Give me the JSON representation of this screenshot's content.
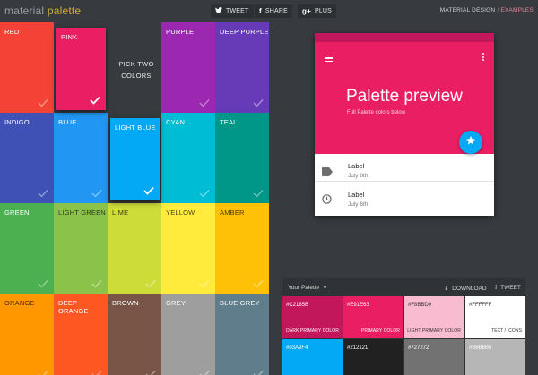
{
  "brand": {
    "part1": "material",
    "part2": "palette"
  },
  "header": {
    "tweet": "TWEET",
    "share": "SHARE",
    "plus": "PLUS",
    "material_design": "MATERIAL DESIGN",
    "separator": "/",
    "examples": "EXAMPLES"
  },
  "grid": {
    "pick_two": "PICK TWO COLORS",
    "colors": [
      {
        "label": "RED",
        "hex": "#F44336",
        "text": "#ffffff"
      },
      {
        "label": "PINK",
        "hex": "#E91E63",
        "text": "#ffffff",
        "selected": true
      },
      {
        "label": "",
        "hex": "#373B3F",
        "text": "#ffffff"
      },
      {
        "label": "PURPLE",
        "hex": "#9C27B0",
        "text": "#ffffff"
      },
      {
        "label": "DEEP PURPLE",
        "hex": "#673AB7",
        "text": "#ffffff"
      },
      {
        "label": "INDIGO",
        "hex": "#3F51B5",
        "text": "#ffffff"
      },
      {
        "label": "BLUE",
        "hex": "#2196F3",
        "text": "#ffffff"
      },
      {
        "label": "LIGHT BLUE",
        "hex": "#03A9F4",
        "text": "#ffffff",
        "selected": true
      },
      {
        "label": "CYAN",
        "hex": "#00BCD4",
        "text": "#ffffff"
      },
      {
        "label": "TEAL",
        "hex": "#009688",
        "text": "#ffffff"
      },
      {
        "label": "GREEN",
        "hex": "#4CAF50",
        "text": "#ffffff"
      },
      {
        "label": "LIGHT GREEN",
        "hex": "#8BC34A",
        "text": "#2f3a22"
      },
      {
        "label": "LIME",
        "hex": "#CDDC39",
        "text": "#3a3f14"
      },
      {
        "label": "YELLOW",
        "hex": "#FFEB3B",
        "text": "#4a4410"
      },
      {
        "label": "AMBER",
        "hex": "#FFC107",
        "text": "#4a3a08"
      },
      {
        "label": "ORANGE",
        "hex": "#FF9800",
        "text": "#4a2e05"
      },
      {
        "label": "DEEP ORANGE",
        "hex": "#FF5722",
        "text": "#ffffff"
      },
      {
        "label": "BROWN",
        "hex": "#795548",
        "text": "#ffffff"
      },
      {
        "label": "GREY",
        "hex": "#9E9E9E",
        "text": "#ffffff"
      },
      {
        "label": "BLUE GREY",
        "hex": "#607D8B",
        "text": "#ffffff"
      }
    ]
  },
  "preview": {
    "title": "Palette preview",
    "subtitle": "Full Palette colors below",
    "primary": "#E91E63",
    "primary_dark": "#C2185B",
    "accent": "#03A9F4",
    "items": [
      {
        "label": "Label",
        "date": "July 8th",
        "icon": "label-icon"
      },
      {
        "label": "Label",
        "date": "July 6th",
        "icon": "clock-icon"
      }
    ]
  },
  "your_palette": {
    "title": "Your Palette",
    "download": "DOWNLOAD",
    "tweet": "TWEET",
    "swatches": [
      {
        "hex": "#C2185B",
        "role": "DARK PRIMARY COLOR",
        "bg": "#C2185B",
        "text": "#ffffff"
      },
      {
        "hex": "#E91E63",
        "role": "PRIMARY COLOR",
        "bg": "#E91E63",
        "text": "#ffffff"
      },
      {
        "hex": "#F8BBD0",
        "role": "LIGHT PRIMARY COLOR",
        "bg": "#F8BBD0",
        "text": "#333333"
      },
      {
        "hex": "#FFFFFF",
        "role": "TEXT / ICONS",
        "bg": "#FFFFFF",
        "text": "#333333"
      },
      {
        "hex": "#03A9F4",
        "role": "",
        "bg": "#03A9F4",
        "text": "#ffffff"
      },
      {
        "hex": "#212121",
        "role": "",
        "bg": "#212121",
        "text": "#ffffff"
      },
      {
        "hex": "#727272",
        "role": "",
        "bg": "#727272",
        "text": "#ffffff"
      },
      {
        "hex": "#B6B6B6",
        "role": "",
        "bg": "#B6B6B6",
        "text": "#ffffff"
      }
    ]
  }
}
